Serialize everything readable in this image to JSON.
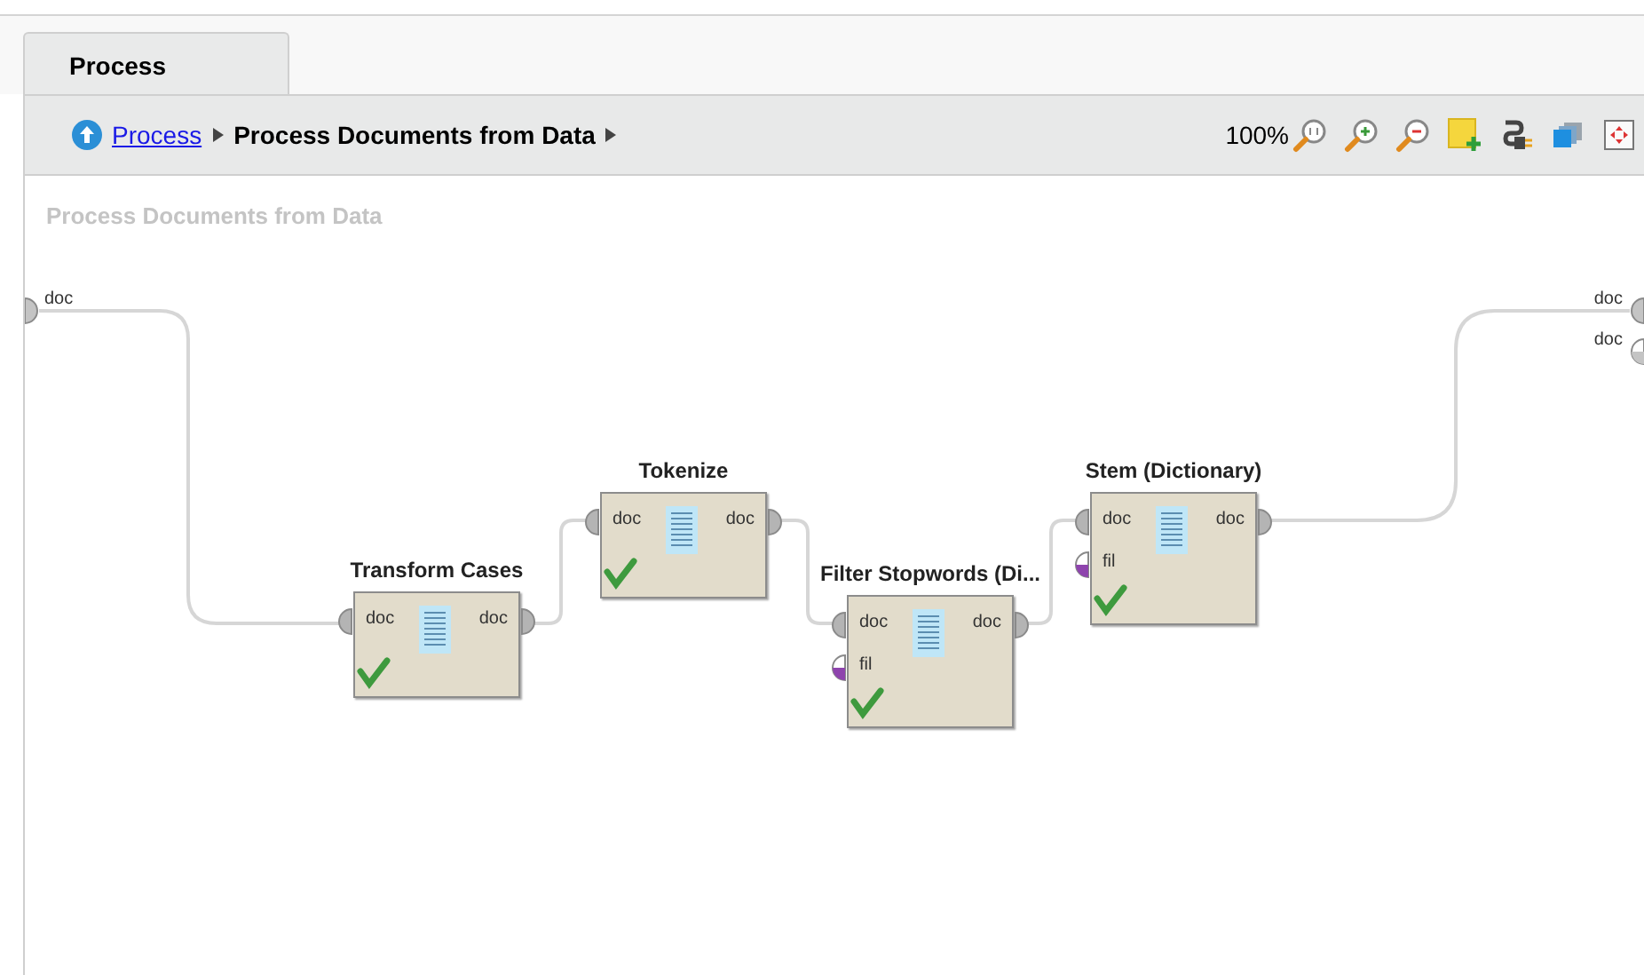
{
  "tab": {
    "label": "Process",
    "selected": true
  },
  "breadcrumb": [
    {
      "label": "Process",
      "kind": "link"
    },
    {
      "label": "Process Documents from Data",
      "kind": "current"
    }
  ],
  "zoom": "100%",
  "canvas": {
    "title": "Process Documents from Data",
    "input_ports": [
      {
        "label": "doc",
        "connected": true
      }
    ],
    "output_ports": [
      {
        "label": "doc",
        "connected": true
      },
      {
        "label": "doc",
        "connected": false
      }
    ],
    "operators": [
      {
        "name": "Transform Cases",
        "inputs": [
          {
            "label": "doc",
            "color": "#b4b4b4",
            "connected": true
          }
        ],
        "outputs": [
          {
            "label": "doc",
            "color": "#b4b4b4",
            "connected": true
          }
        ],
        "ok": true
      },
      {
        "name": "Tokenize",
        "inputs": [
          {
            "label": "doc",
            "color": "#b4b4b4",
            "connected": true
          }
        ],
        "outputs": [
          {
            "label": "doc",
            "color": "#b4b4b4",
            "connected": true
          }
        ],
        "ok": true
      },
      {
        "name": "Filter Stopwords (Di...",
        "inputs": [
          {
            "label": "doc",
            "color": "#b4b4b4",
            "connected": true
          },
          {
            "label": "fil",
            "color": "#8e44ad",
            "connected": false
          }
        ],
        "outputs": [
          {
            "label": "doc",
            "color": "#b4b4b4",
            "connected": true
          }
        ],
        "ok": true
      },
      {
        "name": "Stem (Dictionary)",
        "inputs": [
          {
            "label": "doc",
            "color": "#b4b4b4",
            "connected": true
          },
          {
            "label": "fil",
            "color": "#8e44ad",
            "connected": false
          }
        ],
        "outputs": [
          {
            "label": "doc",
            "color": "#b4b4b4",
            "connected": true
          }
        ],
        "ok": true
      }
    ]
  }
}
